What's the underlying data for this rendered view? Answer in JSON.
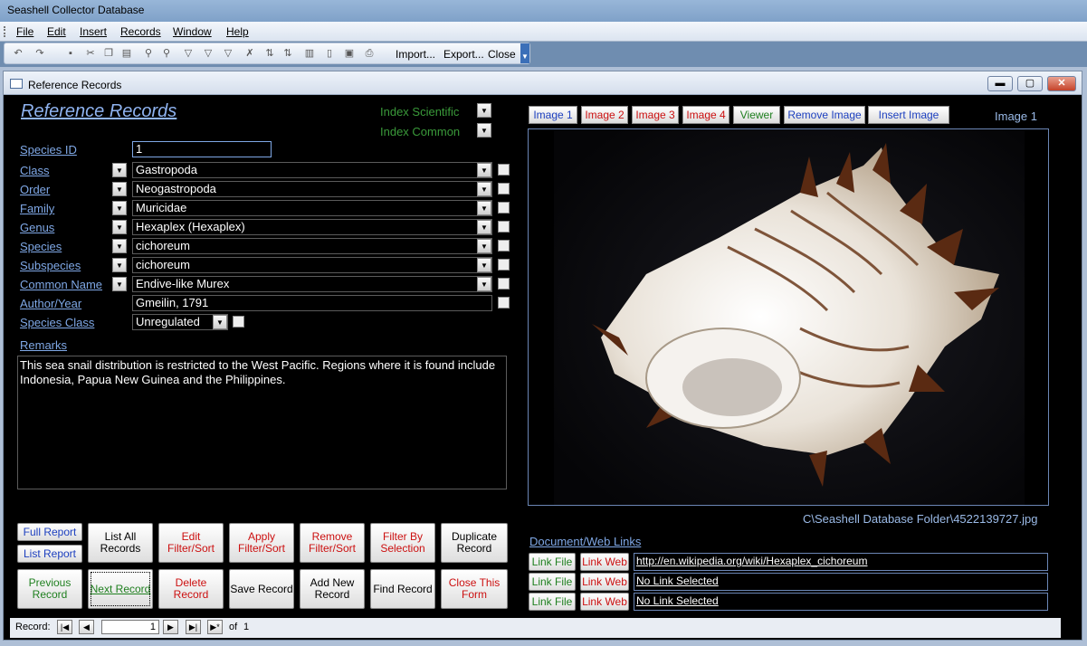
{
  "app": {
    "title": "Seashell Collector Database"
  },
  "menu": [
    "File",
    "Edit",
    "Insert",
    "Records",
    "Window",
    "Help"
  ],
  "toolbar": {
    "import_label": "Import...",
    "export_label": "Export...",
    "close_label": "Close"
  },
  "window": {
    "title": "Reference Records",
    "min": "▬",
    "max": "▢",
    "close": "✕"
  },
  "form": {
    "heading": "Reference Records",
    "index_scientific": "Index Scientific",
    "index_common": "Index Common",
    "species_id": {
      "label": "Species ID",
      "value": "1"
    },
    "fields": [
      {
        "label": "Class",
        "value": "Gastropoda"
      },
      {
        "label": "Order",
        "value": "Neogastropoda"
      },
      {
        "label": "Family",
        "value": "Muricidae"
      },
      {
        "label": "Genus",
        "value": "Hexaplex (Hexaplex)"
      },
      {
        "label": "Species",
        "value": "cichoreum"
      },
      {
        "label": "Subspecies",
        "value": "cichoreum"
      },
      {
        "label": "Common Name",
        "value": "Endive-like Murex"
      }
    ],
    "author_year": {
      "label": "Author/Year",
      "value": "Gmeilin, 1791"
    },
    "species_class": {
      "label": "Species Class",
      "value": "Unregulated"
    },
    "remarks": {
      "label": "Remarks",
      "value": "This sea snail distribution is restricted to the West Pacific. Regions where it is found include Indonesia, Papua New Guinea and the Philippines."
    }
  },
  "image": {
    "buttons": [
      "Image 1",
      "Image 2",
      "Image 3",
      "Image 4",
      "Viewer",
      "Remove Image",
      "Insert Image"
    ],
    "current": "Image 1",
    "path": "C\\Seashell Database Folder\\4522139727.jpg"
  },
  "links": {
    "label": "Document/Web Links",
    "link_file": "Link File",
    "link_web": "Link Web",
    "rows": [
      "http://en.wikipedia.org/wiki/Hexaplex_cichoreum",
      "No Link Selected",
      "No Link Selected"
    ]
  },
  "buttons": {
    "full_report": "Full Report",
    "list_report": "List Report",
    "list_all": "List All Records",
    "edit_filter": "Edit Filter/Sort",
    "apply_filter": "Apply Filter/Sort",
    "remove_filter": "Remove Filter/Sort",
    "filter_selection": "Filter By Selection",
    "duplicate": "Duplicate Record",
    "previous": "Previous Record",
    "next": "Next Record",
    "delete": "Delete Record",
    "save": "Save Record",
    "add_new": "Add New Record",
    "find": "Find Record",
    "close_form": "Close This Form"
  },
  "navigation": {
    "label": "Record:",
    "current": "1",
    "of_label": "of",
    "total": "1"
  },
  "colors": {
    "form_bg": "#000000",
    "label": "#7fa8e6",
    "heading": "#8fb3f0",
    "index_text": "#3a9a3a"
  }
}
